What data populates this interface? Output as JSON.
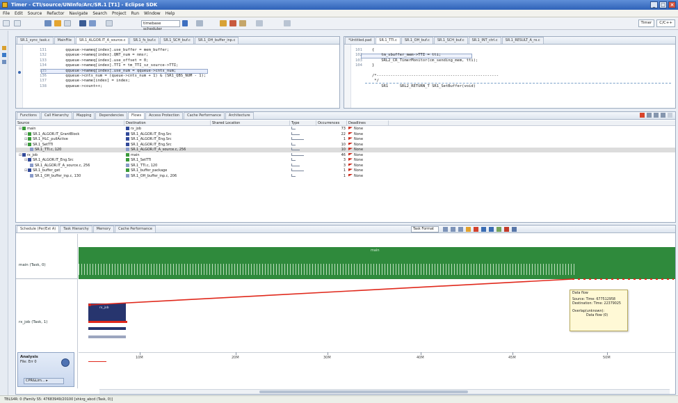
{
  "window": {
    "title": "Timer - CTI/source/UNInfo/Arc/SR.1 [T1] - Eclipse SDK"
  },
  "menu": [
    "File",
    "Edit",
    "Source",
    "Refactor",
    "Navigate",
    "Search",
    "Project",
    "Run",
    "Window",
    "Help"
  ],
  "toolbar": {
    "combo_value": "timebase scheduler",
    "perspectives": [
      "Timer",
      "C/C++"
    ]
  },
  "editor_left": {
    "tabs": [
      "SR.1_sync_task.c",
      "MainFile",
      "SR.1_ALGOR.IT_A_source.c",
      "SR.1_fs_buf.c",
      "SR.1_SCH_buf.c",
      "SR.1_OH_buffer_inp.c"
    ],
    "active_tab": 2,
    "lines": [
      {
        "n": "131",
        "t": "    qqueue->nameq[index].use_buffer = mem_buffer;"
      },
      {
        "n": "132",
        "t": "    qqueue->nameq[index].QNT_num = nmsr;"
      },
      {
        "n": "133",
        "t": "    qqueue->nameq[index].use_offset = 0;"
      },
      {
        "n": "134",
        "t": "    qqueue->nameq[index].TTI = tm_TTI_sz_source->TTI;"
      },
      {
        "n": "135",
        "t": "    qqueue->nameq[index].use_num = qqueue->cnts_num;"
      },
      {
        "n": "136",
        "t": "    qqueue->cnts_num = (queue->cnts_num + 1) & (SR1_QBS_NUM - 1);"
      },
      {
        "n": "137",
        "t": "    qqueue->name[index] = index;"
      },
      {
        "n": "138",
        "t": "    qqueue->count++;"
      }
    ],
    "highlight_line": 3
  },
  "editor_right": {
    "tabs": [
      "*Untitled.pad",
      "SR.1_TTI.c",
      "SR.1_OH_buf.c",
      "SR.1_SCH_buf.c",
      "SR.1_INT_ctrl.c",
      "SR.1_RESULT_A_rx.c"
    ],
    "active_tab": 1,
    "lines": [
      {
        "n": "101",
        "t": "{"
      },
      {
        "n": "102",
        "t": "    tm_sbuffer_mem->TTI = tti;"
      },
      {
        "n": "103",
        "t": "    SRL2_CR_TimerMonitor(cm_sending_mem, tti);"
      },
      {
        "n": "104",
        "t": "}"
      },
      {
        "n": "",
        "t": ""
      },
      {
        "n": "",
        "t": "/*-----------------------------------------------------"
      },
      {
        "n": "",
        "t": " */"
      },
      {
        "n": "",
        "t": "    SR1     SRL2_RETURN_T SR1_SetBuffer(void)"
      }
    ]
  },
  "view_tabs": [
    "Functions",
    "Call Hierarchy",
    "Mapping",
    "Dependencies",
    "Flows",
    "Access Protection",
    "Cache Performance",
    "Architecture"
  ],
  "active_view_tab": 4,
  "flow_table": {
    "headers": [
      "Source",
      "Destination",
      "Shared Location",
      "Type",
      "Occurrences",
      "Deadlines"
    ],
    "rows": [
      {
        "indent": 0,
        "src": "main",
        "src_color": "#3a9a3a",
        "dst": "rx_job",
        "dst_color": "#324a9a",
        "occ": "73",
        "dl": "None"
      },
      {
        "indent": 1,
        "src": "SR.1_ALGOR.IT_GrantBlock",
        "src_color": "#3a9a3a",
        "dst": "SR.1_ALGOR.IT_Eng.Src",
        "dst_color": "#324a9a",
        "occ": "22",
        "dl": "None"
      },
      {
        "indent": 1,
        "src": "SR.1_HLC_pullActive",
        "src_color": "#3a9a3a",
        "dst": "SR.1_ALGOR.IT_Eng.Src",
        "dst_color": "#324a9a",
        "occ": "1",
        "dl": "None"
      },
      {
        "indent": 1,
        "src": "SR.1_SetTTI",
        "src_color": "#3a9a3a",
        "dst": "SR.1_ALGOR.IT_Eng.Src",
        "dst_color": "#324a9a",
        "occ": "10",
        "dl": "None"
      },
      {
        "indent": 2,
        "src": "SR.1_TTI.c, 120",
        "src_color": "#8a9bc9",
        "dst": "SR.1_ALGOR.IT_A_source.c, 256",
        "dst_color": "#8a9bc9",
        "occ": "10",
        "dl": "None",
        "selected": true
      },
      {
        "indent": 0,
        "src": "rx_job",
        "src_color": "#324a9a",
        "dst": "main",
        "dst_color": "#3a9a3a",
        "occ": "46",
        "dl": "None"
      },
      {
        "indent": 1,
        "src": "SR.1_ALGOR.IT_Eng.Src",
        "src_color": "#324a9a",
        "dst": "SR.1_SetTTI",
        "dst_color": "#3a9a3a",
        "occ": "3",
        "dl": "None"
      },
      {
        "indent": 2,
        "src": "SR.1_ALGOR.IT_A_source.c, 256",
        "src_color": "#8a9bc9",
        "dst": "SR.1_TTI.c, 120",
        "dst_color": "#8a9bc9",
        "occ": "3",
        "dl": "None"
      },
      {
        "indent": 1,
        "src": "SR.1_buffer_get",
        "src_color": "#324a9a",
        "dst": "SR.1_buffer_package",
        "dst_color": "#3a9a3a",
        "occ": "1",
        "dl": "None"
      },
      {
        "indent": 2,
        "src": "SR.1_OH_buffer_inp.c, 130",
        "src_color": "#8a9bc9",
        "dst": "SR.1_OH_buffer_inp.c, 206",
        "dst_color": "#8a9bc9",
        "occ": "1",
        "dl": "None"
      }
    ]
  },
  "trace_view": {
    "tabs": [
      "Schedule (Per/Ext A)",
      "Task Hierarchy",
      "Memory",
      "Cache Performance"
    ],
    "format_combo": "Task Format",
    "lanes": [
      "main (Task, 0)",
      "rx_job (Task, 1)"
    ],
    "main_bar_label": "main",
    "rx_bar_label": "rx_job",
    "tooltip": {
      "title": "Data flow",
      "lines": [
        "Source: Time: 677512958",
        "Destination: Time: 22379025",
        "",
        "Overlap(unknown):",
        "Data flow (0)"
      ]
    },
    "ticks": [
      "10M",
      "20M",
      "30M",
      "40M",
      "45M",
      "50M"
    ],
    "analysis": {
      "title": "Analysis",
      "subtitle": "File: Err 0",
      "button": "CPR&Lim... ▸"
    }
  },
  "status": {
    "text": "TBLS4R: 0 (Family S5: 47683949/20100 [shkrg_abcd (Task, 0)]"
  },
  "colors": {
    "main_task": "#2f8a3c",
    "rx_task": "#27356e",
    "flow_line": "#e0281b",
    "accent": "#2f62b8"
  }
}
